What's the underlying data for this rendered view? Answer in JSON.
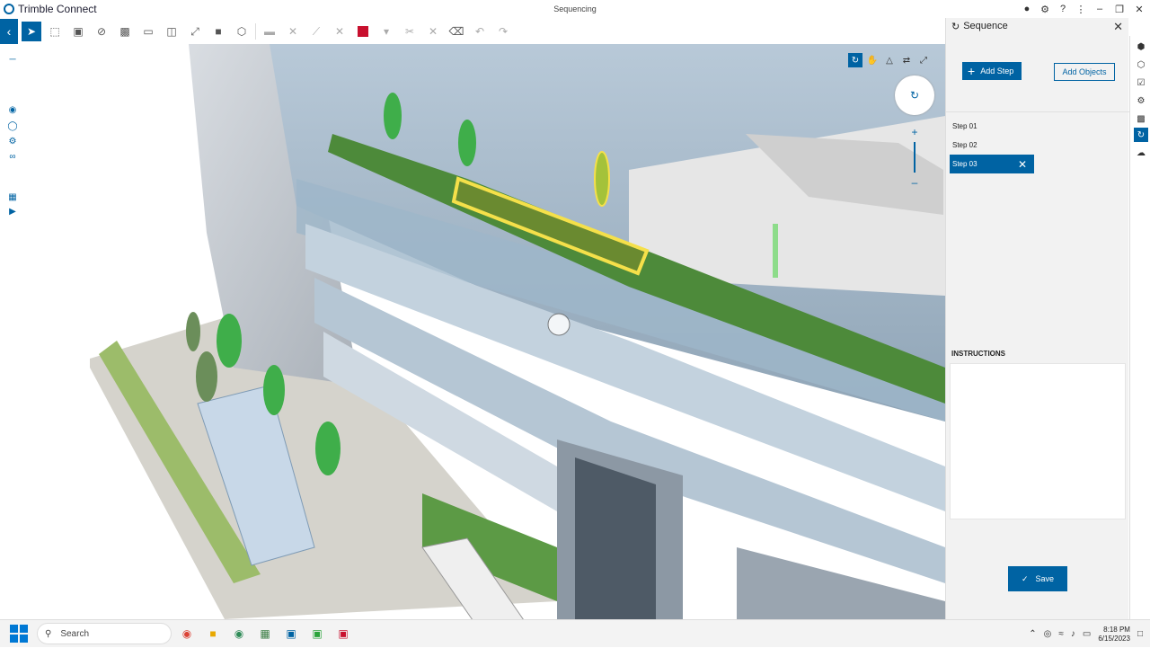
{
  "app": {
    "name": "Trimble Connect",
    "document_title": "Sequencing"
  },
  "toolbar": {
    "back_label": "‹"
  },
  "panel": {
    "title": "Sequence",
    "add_step_label": "Add Step",
    "add_objects_label": "Add Objects",
    "steps": [
      {
        "label": "Step 01",
        "selected": false
      },
      {
        "label": "Step 02",
        "selected": false
      },
      {
        "label": "Step 03",
        "selected": true
      }
    ],
    "instructions_label": "INSTRUCTIONS",
    "instructions_text": "",
    "save_label": "Save"
  },
  "taskbar": {
    "search_placeholder": "Search",
    "time": "8:18 PM",
    "date": "6/15/2023"
  },
  "colors": {
    "accent": "#0063a3",
    "highlight": "#f5e04a",
    "red_swatch": "#c8102e"
  }
}
